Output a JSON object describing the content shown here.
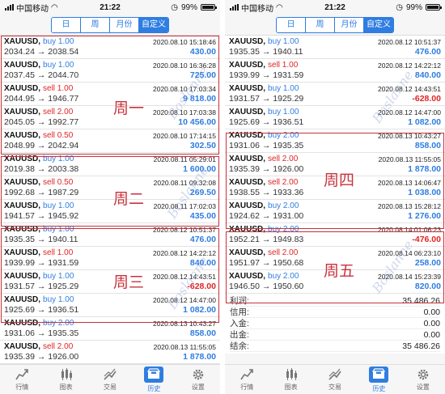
{
  "statusbar": {
    "carrier": "中国移动",
    "time": "21:22",
    "battery": "99%"
  },
  "tabs_segment": [
    "日",
    "周",
    "月份",
    "自定义"
  ],
  "left_rows": [
    {
      "symbol": "XAUUSD,",
      "side": "buy 1.00",
      "side_type": "buy",
      "datetime": "2020.08.10 15:18:46",
      "prices": "2034.24 → 2038.54",
      "profit": "430.00",
      "profit_type": "pos"
    },
    {
      "symbol": "XAUUSD,",
      "side": "buy 1.00",
      "side_type": "buy",
      "datetime": "2020.08.10 16:36:28",
      "prices": "2037.45 → 2044.70",
      "profit": "725.00",
      "profit_type": "pos"
    },
    {
      "symbol": "XAUUSD,",
      "side": "sell 1.00",
      "side_type": "sell",
      "datetime": "2020.08.10 17:03:34",
      "prices": "2044.95 → 1946.77",
      "profit": "9 818.00",
      "profit_type": "pos"
    },
    {
      "symbol": "XAUUSD,",
      "side": "sell 2.00",
      "side_type": "sell",
      "datetime": "2020.08.10 17:03:38",
      "prices": "2045.05 → 1992.77",
      "profit": "10 456.00",
      "profit_type": "pos"
    },
    {
      "symbol": "XAUUSD,",
      "side": "sell 0.50",
      "side_type": "sell",
      "datetime": "2020.08.10 17:14:15",
      "prices": "2048.99 → 2042.94",
      "profit": "302.50",
      "profit_type": "pos"
    },
    {
      "symbol": "XAUUSD,",
      "side": "buy 1.00",
      "side_type": "buy",
      "datetime": "2020.08.11 05:29:01",
      "prices": "2019.38 → 2003.38",
      "profit": "1 600.00",
      "profit_type": "pos"
    },
    {
      "symbol": "XAUUSD,",
      "side": "sell 0.50",
      "side_type": "sell",
      "datetime": "2020.08.11 09:32:08",
      "prices": "1992.68 → 1987.29",
      "profit": "269.50",
      "profit_type": "pos"
    },
    {
      "symbol": "XAUUSD,",
      "side": "buy 1.00",
      "side_type": "buy",
      "datetime": "2020.08.11 17:02:03",
      "prices": "1941.57 → 1945.92",
      "profit": "435.00",
      "profit_type": "pos"
    },
    {
      "symbol": "XAUUSD,",
      "side": "buy 1.00",
      "side_type": "buy",
      "datetime": "2020.08.12 10:51:37",
      "prices": "1935.35 → 1940.11",
      "profit": "476.00",
      "profit_type": "pos"
    },
    {
      "symbol": "XAUUSD,",
      "side": "sell 1.00",
      "side_type": "sell",
      "datetime": "2020.08.12 14:22:12",
      "prices": "1939.99 → 1931.59",
      "profit": "840.00",
      "profit_type": "pos"
    },
    {
      "symbol": "XAUUSD,",
      "side": "buy 1.00",
      "side_type": "buy",
      "datetime": "2020.08.12 14:43:51",
      "prices": "1931.57 → 1925.29",
      "profit": "-628.00",
      "profit_type": "neg"
    },
    {
      "symbol": "XAUUSD,",
      "side": "buy 1.00",
      "side_type": "buy",
      "datetime": "2020.08.12 14:47:00",
      "prices": "1925.69 → 1936.51",
      "profit": "1 082.00",
      "profit_type": "pos"
    },
    {
      "symbol": "XAUUSD,",
      "side": "buy 2.00",
      "side_type": "buy",
      "datetime": "2020.08.13 10:43:27",
      "prices": "1931.06 → 1935.35",
      "profit": "858.00",
      "profit_type": "pos"
    },
    {
      "symbol": "XAUUSD,",
      "side": "sell 2.00",
      "side_type": "sell",
      "datetime": "2020.08.13 11:55:05",
      "prices": "1935.39 → 1926.00",
      "profit": "1 878.00",
      "profit_type": "pos"
    }
  ],
  "right_rows": [
    {
      "symbol": "XAUUSD,",
      "side": "buy 1.00",
      "side_type": "buy",
      "datetime": "2020.08.12 10:51:37",
      "prices": "1935.35 → 1940.11",
      "profit": "476.00",
      "profit_type": "pos"
    },
    {
      "symbol": "XAUUSD,",
      "side": "sell 1.00",
      "side_type": "sell",
      "datetime": "2020.08.12 14:22:12",
      "prices": "1939.99 → 1931.59",
      "profit": "840.00",
      "profit_type": "pos"
    },
    {
      "symbol": "XAUUSD,",
      "side": "buy 1.00",
      "side_type": "buy",
      "datetime": "2020.08.12 14:43:51",
      "prices": "1931.57 → 1925.29",
      "profit": "-628.00",
      "profit_type": "neg"
    },
    {
      "symbol": "XAUUSD,",
      "side": "buy 1.00",
      "side_type": "buy",
      "datetime": "2020.08.12 14:47:00",
      "prices": "1925.69 → 1936.51",
      "profit": "1 082.00",
      "profit_type": "pos"
    },
    {
      "symbol": "XAUUSD,",
      "side": "buy 2.00",
      "side_type": "buy",
      "datetime": "2020.08.13 10:43:27",
      "prices": "1931.06 → 1935.35",
      "profit": "858.00",
      "profit_type": "pos"
    },
    {
      "symbol": "XAUUSD,",
      "side": "sell 2.00",
      "side_type": "sell",
      "datetime": "2020.08.13 11:55:05",
      "prices": "1935.39 → 1926.00",
      "profit": "1 878.00",
      "profit_type": "pos"
    },
    {
      "symbol": "XAUUSD,",
      "side": "sell 2.00",
      "side_type": "sell",
      "datetime": "2020.08.13 14:06:47",
      "prices": "1938.55 → 1933.36",
      "profit": "1 038.00",
      "profit_type": "pos"
    },
    {
      "symbol": "XAUUSD,",
      "side": "buy 2.00",
      "side_type": "buy",
      "datetime": "2020.08.13 15:28:12",
      "prices": "1924.62 → 1931.00",
      "profit": "1 276.00",
      "profit_type": "pos"
    },
    {
      "symbol": "XAUUSD,",
      "side": "buy 2.00",
      "side_type": "buy",
      "datetime": "2020.08.14 01:06:23",
      "prices": "1952.21 → 1949.83",
      "profit": "-476.00",
      "profit_type": "neg"
    },
    {
      "symbol": "XAUUSD,",
      "side": "sell 2.00",
      "side_type": "sell",
      "datetime": "2020.08.14 06:23:10",
      "prices": "1951.97 → 1950.68",
      "profit": "258.00",
      "profit_type": "pos"
    },
    {
      "symbol": "XAUUSD,",
      "side": "buy 2.00",
      "side_type": "buy",
      "datetime": "2020.08.14 15:23:39",
      "prices": "1946.50 → 1950.60",
      "profit": "820.00",
      "profit_type": "pos"
    }
  ],
  "week_labels": {
    "mon": "周一",
    "tue": "周二",
    "wed": "周三",
    "thu": "周四",
    "fri": "周五"
  },
  "watermark": "Boslanne",
  "summary": [
    {
      "label": "利润:",
      "value": "35 486.26"
    },
    {
      "label": "信用:",
      "value": "0.00"
    },
    {
      "label": "入金:",
      "value": "0.00"
    },
    {
      "label": "出金:",
      "value": "0.00"
    },
    {
      "label": "结余:",
      "value": "35 486.26"
    }
  ],
  "tabbar": [
    "行情",
    "图表",
    "交易",
    "历史",
    "设置"
  ],
  "colors": {
    "accent": "#2f7de1",
    "sell": "#e02424",
    "box": "#c8323c"
  }
}
